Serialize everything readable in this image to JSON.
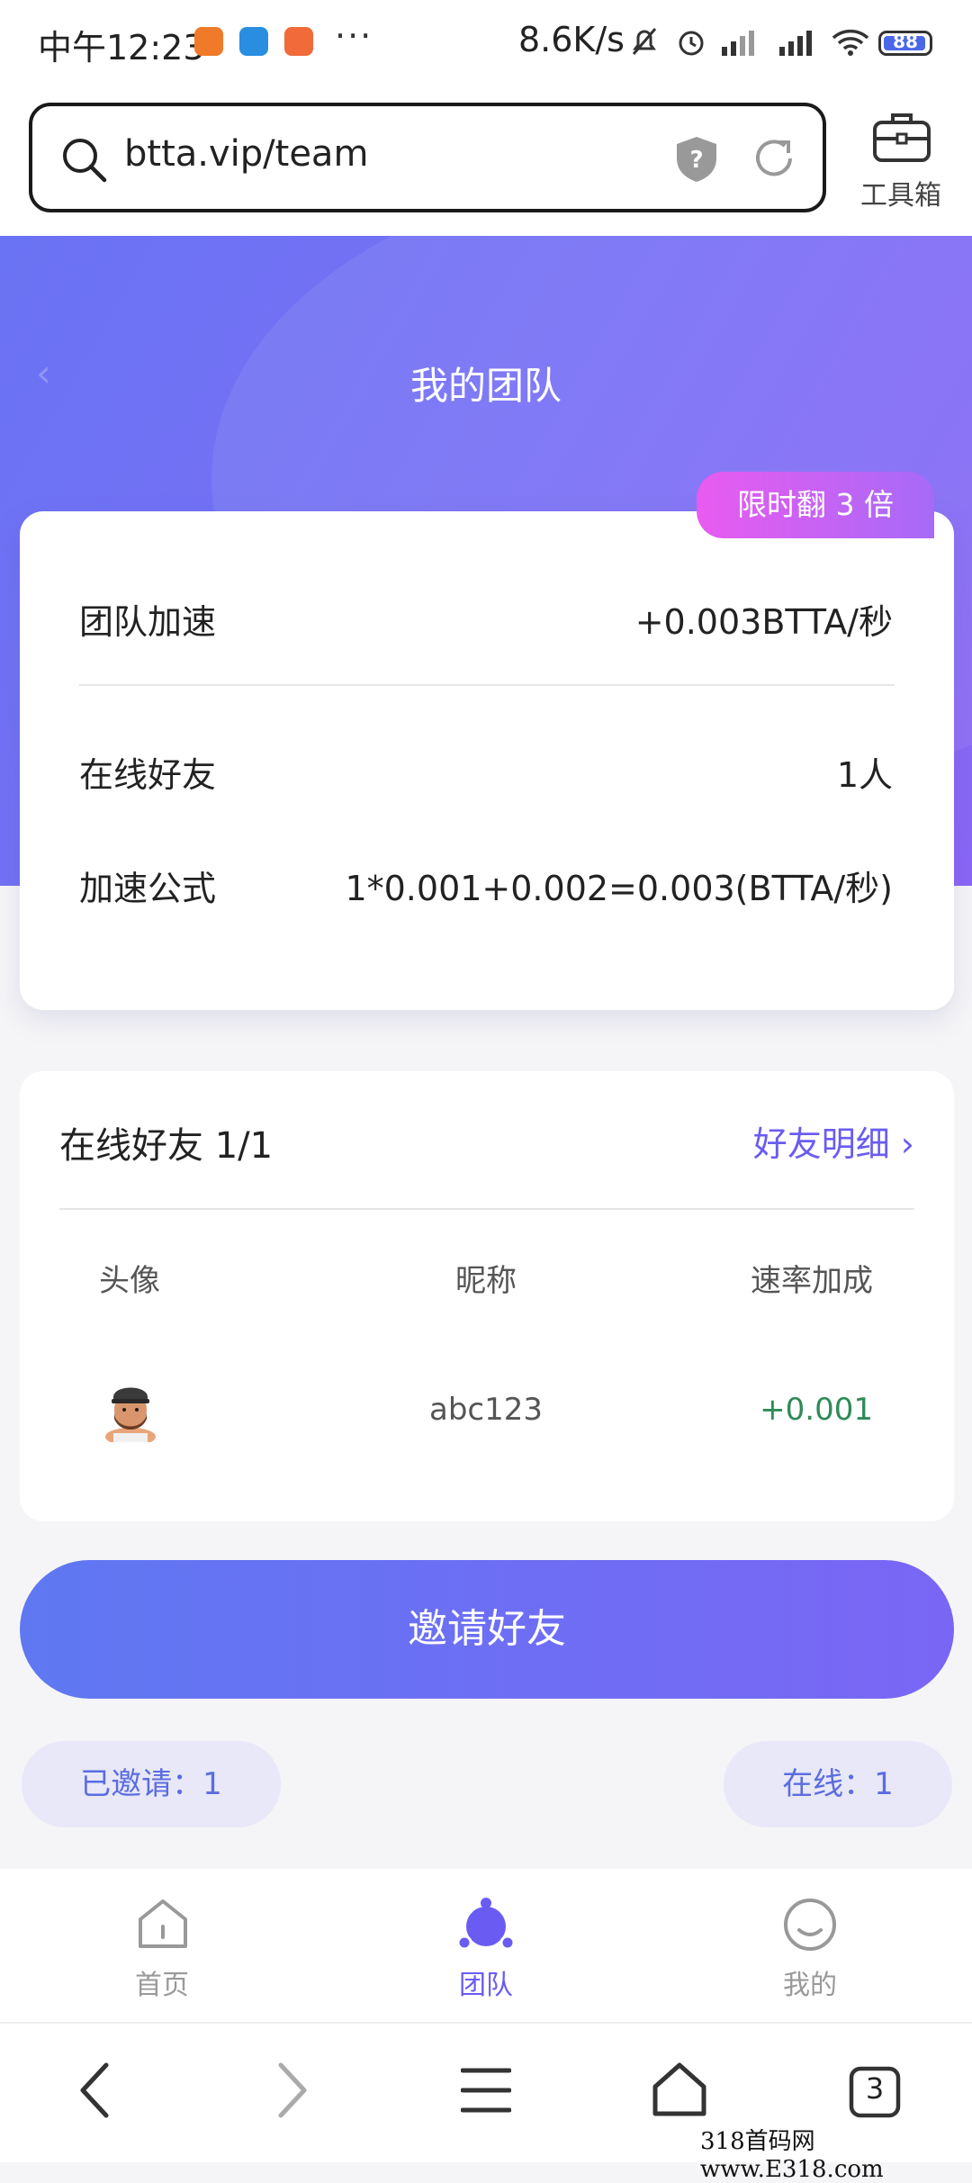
{
  "status_bar": {
    "time": "中午12:23",
    "more": "···",
    "net_speed": "8.6K/s",
    "battery": "88"
  },
  "browser": {
    "url": "btta.vip/team",
    "toolbox_label": "工具箱"
  },
  "page": {
    "title": "我的团队",
    "promo_badge": "限时翻 3 倍"
  },
  "summary": {
    "rows": [
      {
        "label": "团队加速",
        "value": "+0.003BTTA/秒"
      },
      {
        "label": "在线好友",
        "value": "1人"
      },
      {
        "label": "加速公式",
        "value": "1*0.001+0.002=0.003(BTTA/秒)"
      }
    ]
  },
  "friends": {
    "title": "在线好友 1/1",
    "details_link": "好友明细 ›",
    "columns": [
      "头像",
      "昵称",
      "速率加成"
    ],
    "rows": [
      {
        "nickname": "abc123",
        "rate": "+0.001"
      }
    ]
  },
  "invite": {
    "button": "邀请好友",
    "invited": "已邀请：1",
    "online": "在线：1"
  },
  "tabbar": {
    "items": [
      {
        "label": "首页"
      },
      {
        "label": "团队"
      },
      {
        "label": "我的"
      }
    ]
  },
  "system_nav": {
    "tabs_count": "3"
  },
  "watermark": "318首码网 www.E318.com",
  "colors": {
    "accent": "#6a5cf2",
    "hero_start": "#6a73f3",
    "hero_end": "#8a66f5",
    "promo_start": "#e95bf0",
    "positive": "#2e8b57"
  }
}
